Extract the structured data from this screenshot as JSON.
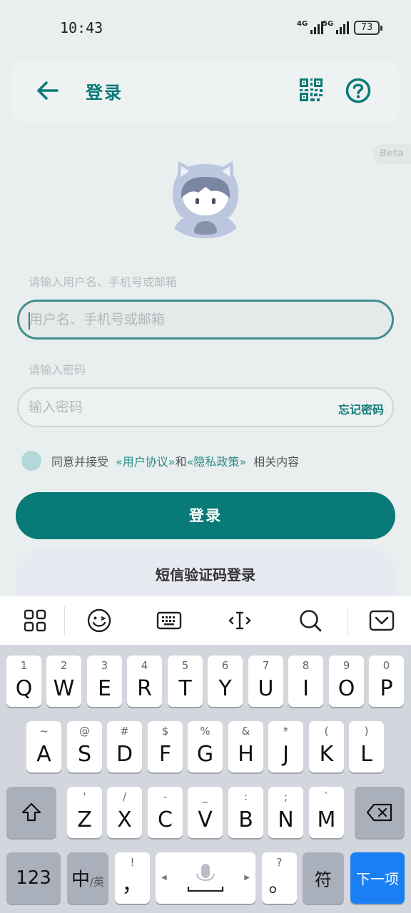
{
  "status": {
    "time": "10:43",
    "net1": "4G",
    "net2": "5G",
    "battery": "73"
  },
  "header": {
    "title": "登录",
    "back_icon": "arrow-left-icon",
    "qr_icon": "qr-code-icon",
    "help_icon": "help-circle-icon"
  },
  "beta": "Beta",
  "username": {
    "hint": "请输入用户名、手机号或邮箱",
    "placeholder": "用户名、手机号或邮箱"
  },
  "password": {
    "hint": "请输入密码",
    "placeholder": "输入密码",
    "forgot": "忘记密码"
  },
  "agreement": {
    "prefix": "同意并接受",
    "user_agreement": "«用户协议»",
    "and": "和",
    "privacy": "«隐私政策»",
    "suffix": "相关内容"
  },
  "buttons": {
    "login": "登录",
    "sms_login": "短信验证码登录"
  },
  "colors": {
    "accent": "#087a78",
    "background": "#e9eeef",
    "next_key": "#1a7ff2"
  },
  "keyboard": {
    "toolbar": [
      "grid-icon",
      "emoji-icon",
      "keyboard-icon",
      "cursor-icon",
      "search-icon",
      "collapse-keyboard-icon"
    ],
    "row1": [
      {
        "main": "Q",
        "sup": "1"
      },
      {
        "main": "W",
        "sup": "2"
      },
      {
        "main": "E",
        "sup": "3"
      },
      {
        "main": "R",
        "sup": "4"
      },
      {
        "main": "T",
        "sup": "5"
      },
      {
        "main": "Y",
        "sup": "6"
      },
      {
        "main": "U",
        "sup": "7"
      },
      {
        "main": "I",
        "sup": "8"
      },
      {
        "main": "O",
        "sup": "9"
      },
      {
        "main": "P",
        "sup": "0"
      }
    ],
    "row2": [
      {
        "main": "A",
        "sup": "~"
      },
      {
        "main": "S",
        "sup": "@"
      },
      {
        "main": "D",
        "sup": "#"
      },
      {
        "main": "F",
        "sup": "$"
      },
      {
        "main": "G",
        "sup": "%"
      },
      {
        "main": "H",
        "sup": "&"
      },
      {
        "main": "J",
        "sup": "*"
      },
      {
        "main": "K",
        "sup": "("
      },
      {
        "main": "L",
        "sup": ")"
      }
    ],
    "row3": [
      {
        "main": "Z",
        "sup": "'"
      },
      {
        "main": "X",
        "sup": "/"
      },
      {
        "main": "C",
        "sup": "-"
      },
      {
        "main": "V",
        "sup": "_"
      },
      {
        "main": "B",
        "sup": ":"
      },
      {
        "main": "N",
        "sup": ";"
      },
      {
        "main": "M",
        "sup": "`"
      }
    ],
    "num": "123",
    "lang": "中",
    "lang_sub": "/英",
    "comma": "，",
    "comma_sup": "!",
    "period": "。",
    "period_sup": "?",
    "symbol": "符",
    "next": "下一项"
  }
}
